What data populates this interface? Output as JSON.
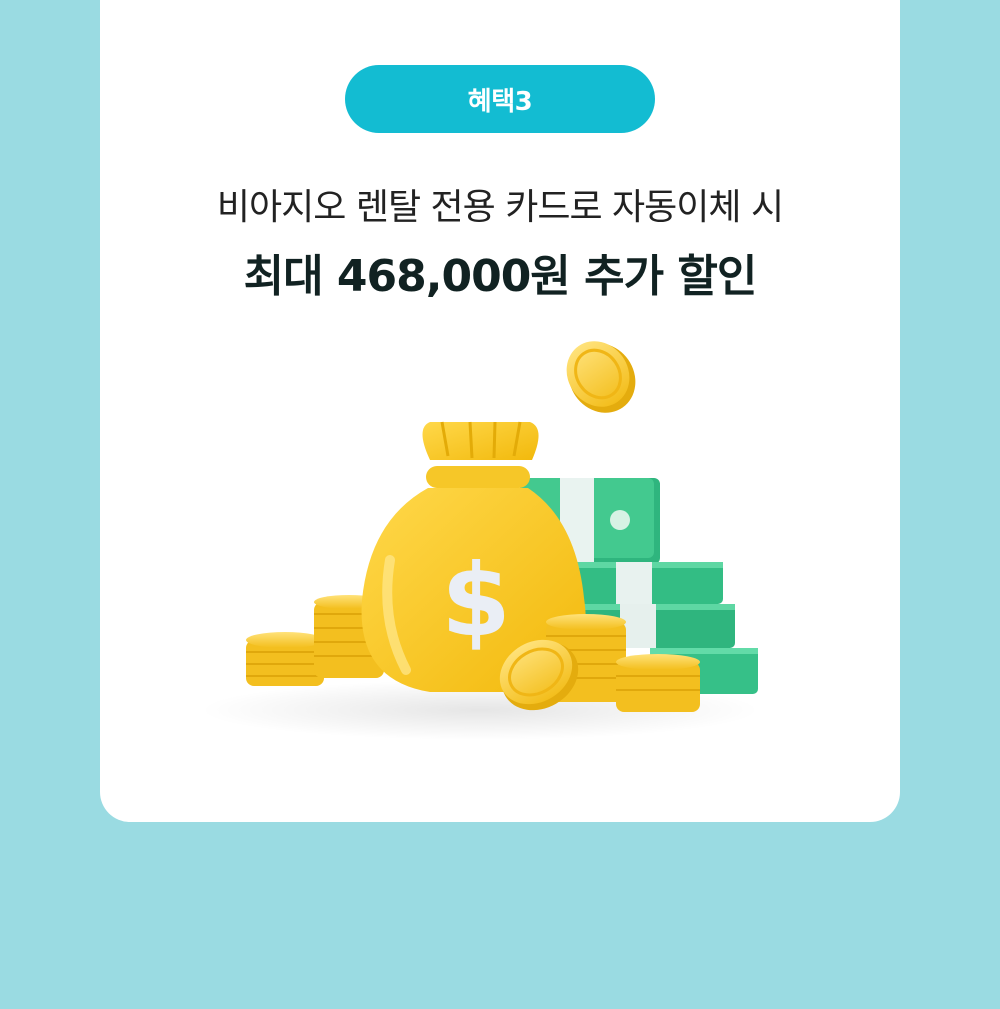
{
  "badge": {
    "label": "혜택3"
  },
  "subtitle": "비아지오 렌탈 전용 카드로 자동이체 시",
  "headline": "최대 468,000원 추가 할인",
  "colors": {
    "page_background": "#9adbe2",
    "card_background": "#ffffff",
    "badge_background": "#13bcd2",
    "coin_gold": "#f7c927",
    "cash_green": "#3cc48a"
  },
  "illustration": {
    "icons": [
      "money-bag-icon",
      "dollar-sign-icon",
      "coin-stack-icon",
      "cash-stack-icon"
    ]
  }
}
